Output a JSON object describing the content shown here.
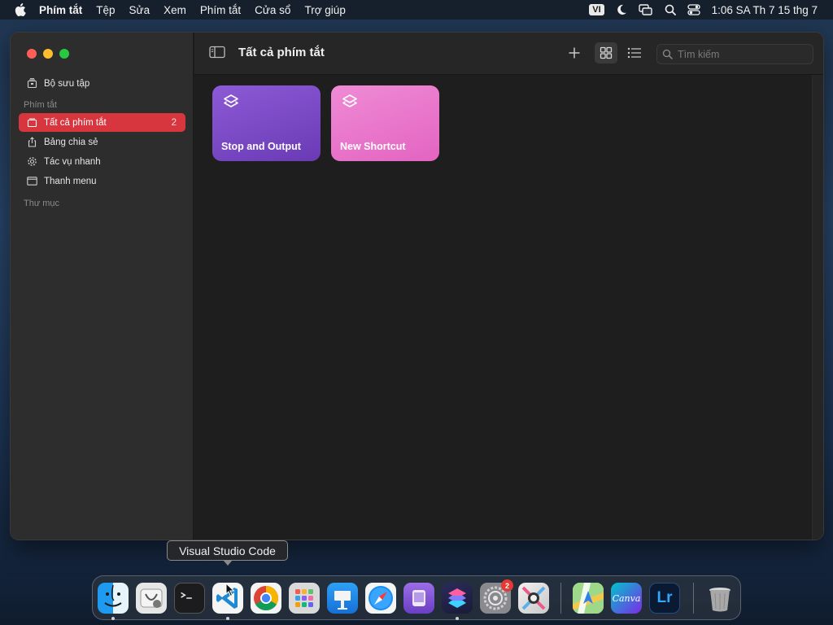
{
  "menubar": {
    "app_name": "Phím tắt",
    "items": [
      "Tệp",
      "Sửa",
      "Xem",
      "Phím tắt",
      "Cửa sổ",
      "Trợ giúp"
    ],
    "input_source": "VI",
    "clock": "1:06 SA Th 7 15 thg 7"
  },
  "sidebar": {
    "top_item": {
      "label": "Bộ sưu tập",
      "icon": "gallery-icon"
    },
    "section_shortcuts": "Phím tắt",
    "items": [
      {
        "label": "Tất cả phím tắt",
        "count": "2",
        "icon": "all-shortcuts-icon",
        "selected": true
      },
      {
        "label": "Bảng chia sẻ",
        "icon": "share-sheet-icon"
      },
      {
        "label": "Tác vụ nhanh",
        "icon": "quick-actions-gear-icon"
      },
      {
        "label": "Thanh menu",
        "icon": "menu-bar-icon"
      }
    ],
    "section_folders": "Thư mục"
  },
  "toolbar": {
    "title": "Tất cả phím tắt",
    "search_placeholder": "Tìm kiếm",
    "view_mode": "grid"
  },
  "shortcuts": [
    {
      "name": "Stop and Output",
      "color": "#7c4bc9"
    },
    {
      "name": "New Shortcut",
      "color": "#e977cb"
    }
  ],
  "tooltip": {
    "text": "Visual Studio Code"
  },
  "dock": {
    "apps": [
      {
        "name": "Finder",
        "icon": "finder-icon",
        "running": true
      },
      {
        "name": "Disk Utility",
        "icon": "disk-utility-icon",
        "running": false
      },
      {
        "name": "Terminal",
        "icon": "terminal-icon",
        "running": false
      },
      {
        "name": "Visual Studio Code",
        "icon": "vscode-icon",
        "running": true
      },
      {
        "name": "Google Chrome",
        "icon": "chrome-icon",
        "running": false
      },
      {
        "name": "Launchpad",
        "icon": "launchpad-icon",
        "running": false
      },
      {
        "name": "Keynote",
        "icon": "keynote-icon",
        "running": false
      },
      {
        "name": "Safari",
        "icon": "safari-icon",
        "running": false
      },
      {
        "name": "Simulator",
        "icon": "simulator-icon",
        "running": false
      },
      {
        "name": "Shortcuts",
        "icon": "shortcuts-icon",
        "running": true
      },
      {
        "name": "System Settings",
        "icon": "system-settings-icon",
        "badge": "2",
        "running": false
      },
      {
        "name": "Xcode Instruments",
        "icon": "instruments-icon",
        "running": false
      },
      {
        "name": "Maps",
        "icon": "maps-icon",
        "running": false
      },
      {
        "name": "Canva",
        "icon": "canva-icon",
        "label": "Canva",
        "running": false
      },
      {
        "name": "Lightroom",
        "icon": "lightroom-icon",
        "label": "Lr",
        "running": false
      },
      {
        "name": "Trash",
        "icon": "trash-icon",
        "running": false
      }
    ]
  }
}
